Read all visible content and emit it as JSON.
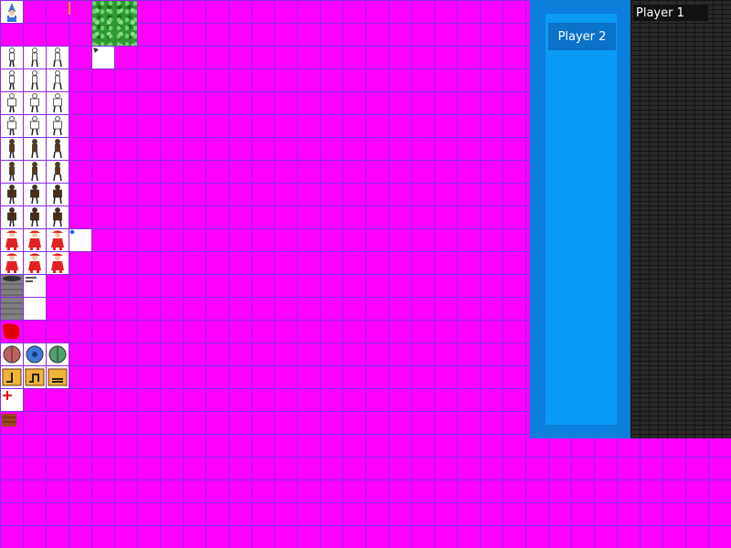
{
  "players": {
    "player1_label": "Player 1",
    "player2_label": "Player 2"
  },
  "colors": {
    "background": "#ff00ff",
    "grid": "#8a2be2",
    "tile": "#ffffff",
    "blue_panel": "#0a7fdc",
    "blue_inner": "#0a9cf5",
    "brick": "#2a2a2a"
  },
  "sprites": {
    "wizard": "wizard-sprite",
    "grass": "grass-tile",
    "white_guy": "white-walking-figure",
    "white_hero": "white-hero-figure",
    "brown_guy": "brown-walking-figure",
    "brown_hero": "brown-hero-figure",
    "red_guy": "red-figure",
    "ring": "ring-icon",
    "stone": "stone-column",
    "blood": "blood-splat",
    "orbs": [
      "red-orb-icon",
      "blue-orb-icon",
      "green-orb-icon"
    ],
    "gold_tiles": [
      "tile-up-icon",
      "tile-down-icon",
      "tile-flat-icon"
    ],
    "cross": "red-cross-icon",
    "chest": "chest-icon"
  }
}
